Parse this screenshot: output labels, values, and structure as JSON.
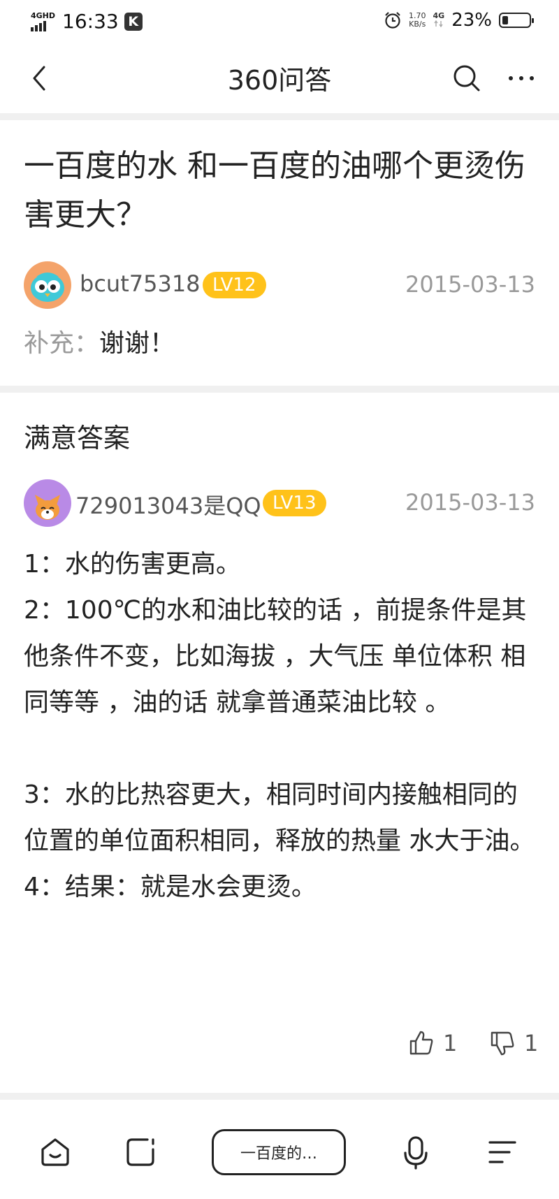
{
  "status_bar": {
    "network_label": "4GHD",
    "time": "16:33",
    "badge": "K",
    "speed_value": "1.70",
    "speed_unit": "KB/s",
    "network_type": "4G",
    "battery_percent": "23%",
    "battery_level": 0.23
  },
  "nav": {
    "title": "360问答"
  },
  "question": {
    "title": "一百度的水 和一百度的油哪个更烫伤害更大？",
    "author": "bcut75318",
    "level": "LV12",
    "date": "2015-03-13",
    "supplement_label": "补充：",
    "supplement_text": "谢谢！"
  },
  "answer": {
    "section_title": "满意答案",
    "author": "729013043是QQ",
    "level": "LV13",
    "date": "2015-03-13",
    "paragraphs": [
      "1：水的伤害更高。",
      "2：100℃的水和油比较的话 ，前提条件是其他条件不变，比如海拔 ，大气压 单位体积 相同等等 ，油的话 就拿普通菜油比较 。",
      "",
      "3：水的比热容更大，相同时间内接触相同的位置的单位面积相同，释放的热量 水大于油。",
      "4：结果：就是水会更烫。"
    ],
    "likes": "1",
    "dislikes": "1"
  },
  "bottom_nav": {
    "search_text": "一百度的…",
    "icons": [
      "home-icon",
      "edit-icon",
      "mic-icon",
      "menu-icon"
    ]
  },
  "colors": {
    "level_badge": "#ffc21a",
    "divider": "#f0f0f0",
    "muted_text": "#999999"
  }
}
